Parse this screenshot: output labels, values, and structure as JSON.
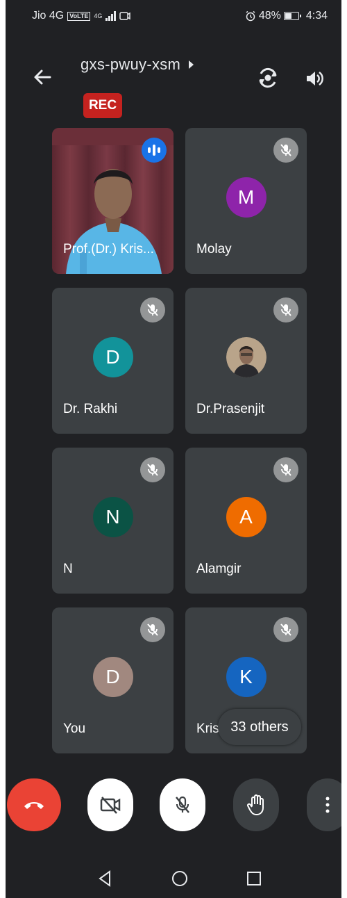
{
  "status_bar": {
    "carrier": "Jio 4G",
    "volte": "VoLTE",
    "network": "4G",
    "battery": "48%",
    "time": "4:34",
    "icons": [
      "alarm-icon",
      "battery-icon",
      "signal-icon",
      "screen-record-icon"
    ]
  },
  "header": {
    "meeting_code": "gxs-pwuy-xsm",
    "rec_label": "REC",
    "icons": [
      "back-arrow-icon",
      "switch-camera-icon",
      "speaker-icon",
      "chevron-right-icon"
    ]
  },
  "participants": [
    {
      "name": "Prof.(Dr.) Kris...",
      "type": "video",
      "speaking": true
    },
    {
      "name": "Molay",
      "initial": "M",
      "color": "#8e24aa",
      "muted": true
    },
    {
      "name": "Dr. Rakhi",
      "initial": "D",
      "color": "#12939a",
      "muted": true
    },
    {
      "name": "Dr.Prasenjit",
      "type": "photo",
      "muted": true
    },
    {
      "name": "N",
      "initial": "N",
      "color": "#0b5345",
      "muted": true
    },
    {
      "name": "Alamgir",
      "initial": "A",
      "color": "#ef6c00",
      "muted": true
    },
    {
      "name": "You",
      "initial": "D",
      "color": "#a1887f",
      "muted": true
    },
    {
      "name": "Kris",
      "initial": "K",
      "color": "#1565c0",
      "muted": true
    }
  ],
  "others_label": "33 others",
  "controls": {
    "icons": [
      "end-call-icon",
      "camera-off-icon",
      "mic-off-icon",
      "raise-hand-icon",
      "more-vert-icon"
    ]
  },
  "nav": {
    "icons": [
      "back-triangle-icon",
      "home-circle-icon",
      "recents-square-icon"
    ]
  },
  "colors": {
    "background": "#202124",
    "tile": "#3c4043",
    "rec": "#c5221f",
    "end_call": "#ea4335",
    "speaking": "#1a73e8"
  }
}
